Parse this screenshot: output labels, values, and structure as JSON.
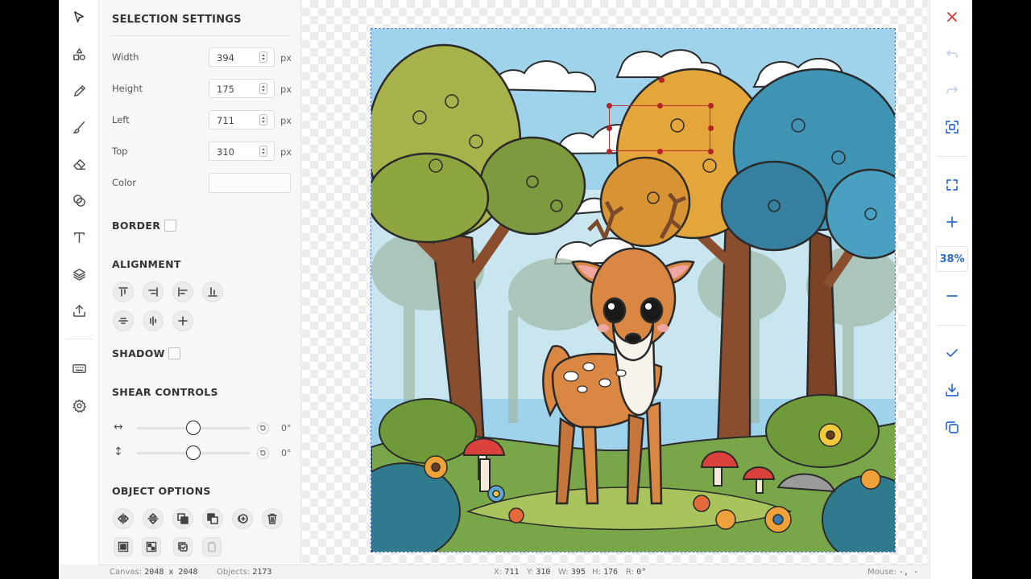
{
  "panel": {
    "title": "SELECTION SETTINGS",
    "fields": [
      {
        "label": "Width",
        "value": "394",
        "unit": "px"
      },
      {
        "label": "Height",
        "value": "175",
        "unit": "px"
      },
      {
        "label": "Left",
        "value": "711",
        "unit": "px"
      },
      {
        "label": "Top",
        "value": "310",
        "unit": "px"
      }
    ],
    "color_label": "Color",
    "color_value": "#fcfcfa",
    "border_label": "BORDER",
    "alignment_label": "ALIGNMENT",
    "shadow_label": "SHADOW",
    "shear_label": "SHEAR CONTROLS",
    "shear_h": {
      "icon": "↔",
      "value": "0°"
    },
    "shear_v": {
      "icon": "↕",
      "value": "0°"
    },
    "object_options_label": "OBJECT OPTIONS"
  },
  "left_toolbar": [
    "select-tool-icon",
    "shapes-icon",
    "pencil-icon",
    "brush-icon",
    "eraser-icon",
    "filters-icon",
    "text-icon",
    "layers-icon",
    "upload-icon",
    "keyboard-icon",
    "settings-icon"
  ],
  "right_toolbar": {
    "zoom": "38%",
    "icons": [
      "close-icon",
      "undo-icon",
      "redo-icon",
      "fit-selection-icon",
      "fullscreen-icon",
      "zoom-in-icon",
      "zoom-out-icon",
      "apply-icon",
      "download-icon",
      "copy-icon"
    ]
  },
  "status": {
    "canvas_label": "Canvas:",
    "canvas_value": "2048 x 2048",
    "objects_label": "Objects:",
    "objects_value": "2173",
    "x_label": "X:",
    "x_value": "711",
    "y_label": "Y:",
    "y_value": "310",
    "w_label": "W:",
    "w_value": "395",
    "h_label": "H:",
    "h_value": "176",
    "r_label": "R:",
    "r_value": "0°",
    "mouse_label": "Mouse:",
    "mouse_value": "-, -"
  },
  "colors": {
    "accent": "#2f6ccf",
    "close": "#d9332b",
    "selection": "#b3232a"
  }
}
